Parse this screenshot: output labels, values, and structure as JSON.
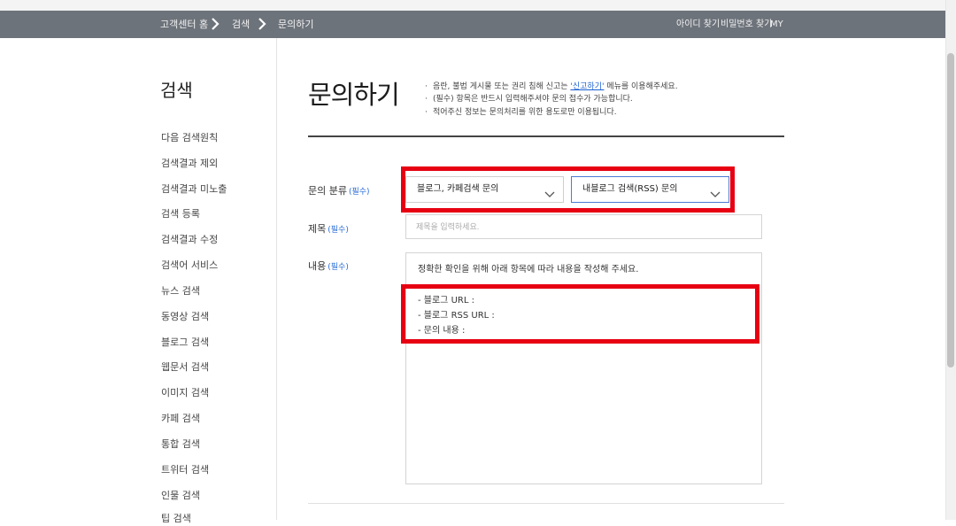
{
  "breadcrumb": {
    "home": "고객센터 홈",
    "level1": "검색",
    "current": "문의하기"
  },
  "top_links": {
    "find_id": "아이디 찾기",
    "find_password": "비밀번호 찾기",
    "my": "MY"
  },
  "sidebar": {
    "title": "검색",
    "items": [
      {
        "label": "다음 검색원칙"
      },
      {
        "label": "검색결과 제외"
      },
      {
        "label": "검색결과 미노출"
      },
      {
        "label": "검색 등록"
      },
      {
        "label": "검색결과 수정"
      },
      {
        "label": "검색어 서비스"
      },
      {
        "label": "뉴스 검색"
      },
      {
        "label": "동영상 검색"
      },
      {
        "label": "블로그 검색"
      },
      {
        "label": "웹문서 검색"
      },
      {
        "label": "이미지 검색"
      },
      {
        "label": "카페 검색"
      },
      {
        "label": "통합 검색"
      },
      {
        "label": "트위터 검색"
      },
      {
        "label": "인물 검색"
      },
      {
        "label": "팁 검색"
      }
    ]
  },
  "main": {
    "title": "문의하기",
    "notices": [
      {
        "before": "음란, 불법 게시물 또는 권리 침해 신고는 ",
        "link": "'신고하기'",
        "after": " 메뉴를 이용해주세요."
      },
      {
        "before": "(필수) 항목은 반드시 입력해주셔야 문의 접수가 가능합니다.",
        "link": "",
        "after": ""
      },
      {
        "before": "적어주신 정보는 문의처리를 위한 용도로만 이용됩니다.",
        "link": "",
        "after": ""
      }
    ],
    "form": {
      "category_label": "문의 분류",
      "title_label": "제목",
      "content_label": "내용",
      "required_tag": "(필수)",
      "category_primary": "블로그, 카페검색 문의",
      "category_secondary": "내블로그 검색(RSS) 문의",
      "title_placeholder": "제목을 입력하세요.",
      "content_intro": "정확한 확인을 위해 아래 항목에 따라 내용을 작성해 주세요.",
      "content_items": [
        "- 블로그 URL :",
        "- 블로그 RSS URL :",
        "- 문의 내용 :"
      ]
    }
  },
  "colors": {
    "nav_bar": "#6d737b",
    "highlight": "#e60012",
    "required": "#2a6cd6"
  }
}
